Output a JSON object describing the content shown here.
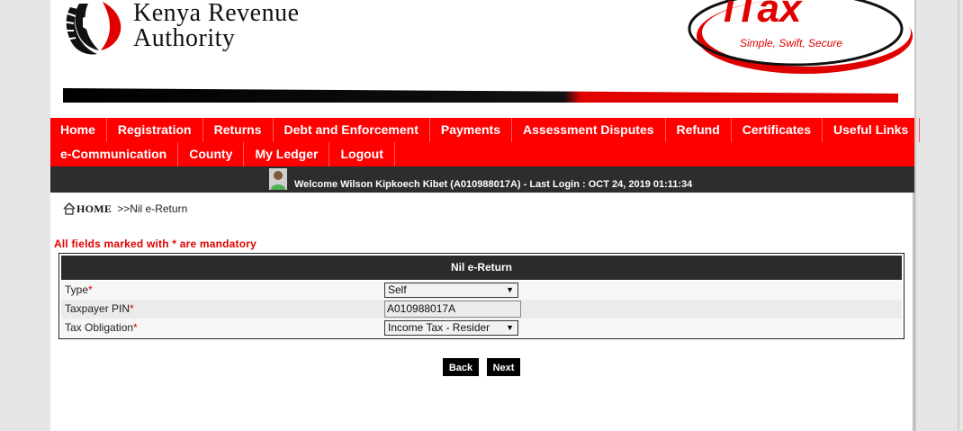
{
  "header": {
    "kra_name_line1": "Kenya Revenue",
    "kra_name_line2": "Authority",
    "itax_brand": "iTax",
    "itax_tagline": "Simple, Swift, Secure"
  },
  "nav": {
    "row1": [
      "Home",
      "Registration",
      "Returns",
      "Debt and Enforcement",
      "Payments",
      "Assessment Disputes",
      "Refund",
      "Certificates",
      "Useful Links"
    ],
    "row2": [
      "e-Communication",
      "County",
      "My Ledger",
      "Logout"
    ]
  },
  "welcome": {
    "text": "Welcome Wilson Kipkoech Kibet (A010988017A)  - Last Login : OCT 24, 2019 01:11:34"
  },
  "breadcrumb": {
    "home": "HOME",
    "current": ">>Nil e-Return"
  },
  "mandatory_note": "All fields marked with * are mandatory",
  "form": {
    "title": "Nil e-Return",
    "fields": [
      {
        "label": "Type",
        "required": "*",
        "value": "Self"
      },
      {
        "label": "Taxpayer PIN",
        "required": "*",
        "value": "A010988017A"
      },
      {
        "label": "Tax Obligation",
        "required": "*",
        "value": "Income Tax - Resider"
      }
    ]
  },
  "buttons": {
    "back": "Back",
    "next": "Next"
  },
  "colors": {
    "nav_red": "#ff0000",
    "dark_bar": "#2d2d2d",
    "required_red": "#e00000"
  }
}
